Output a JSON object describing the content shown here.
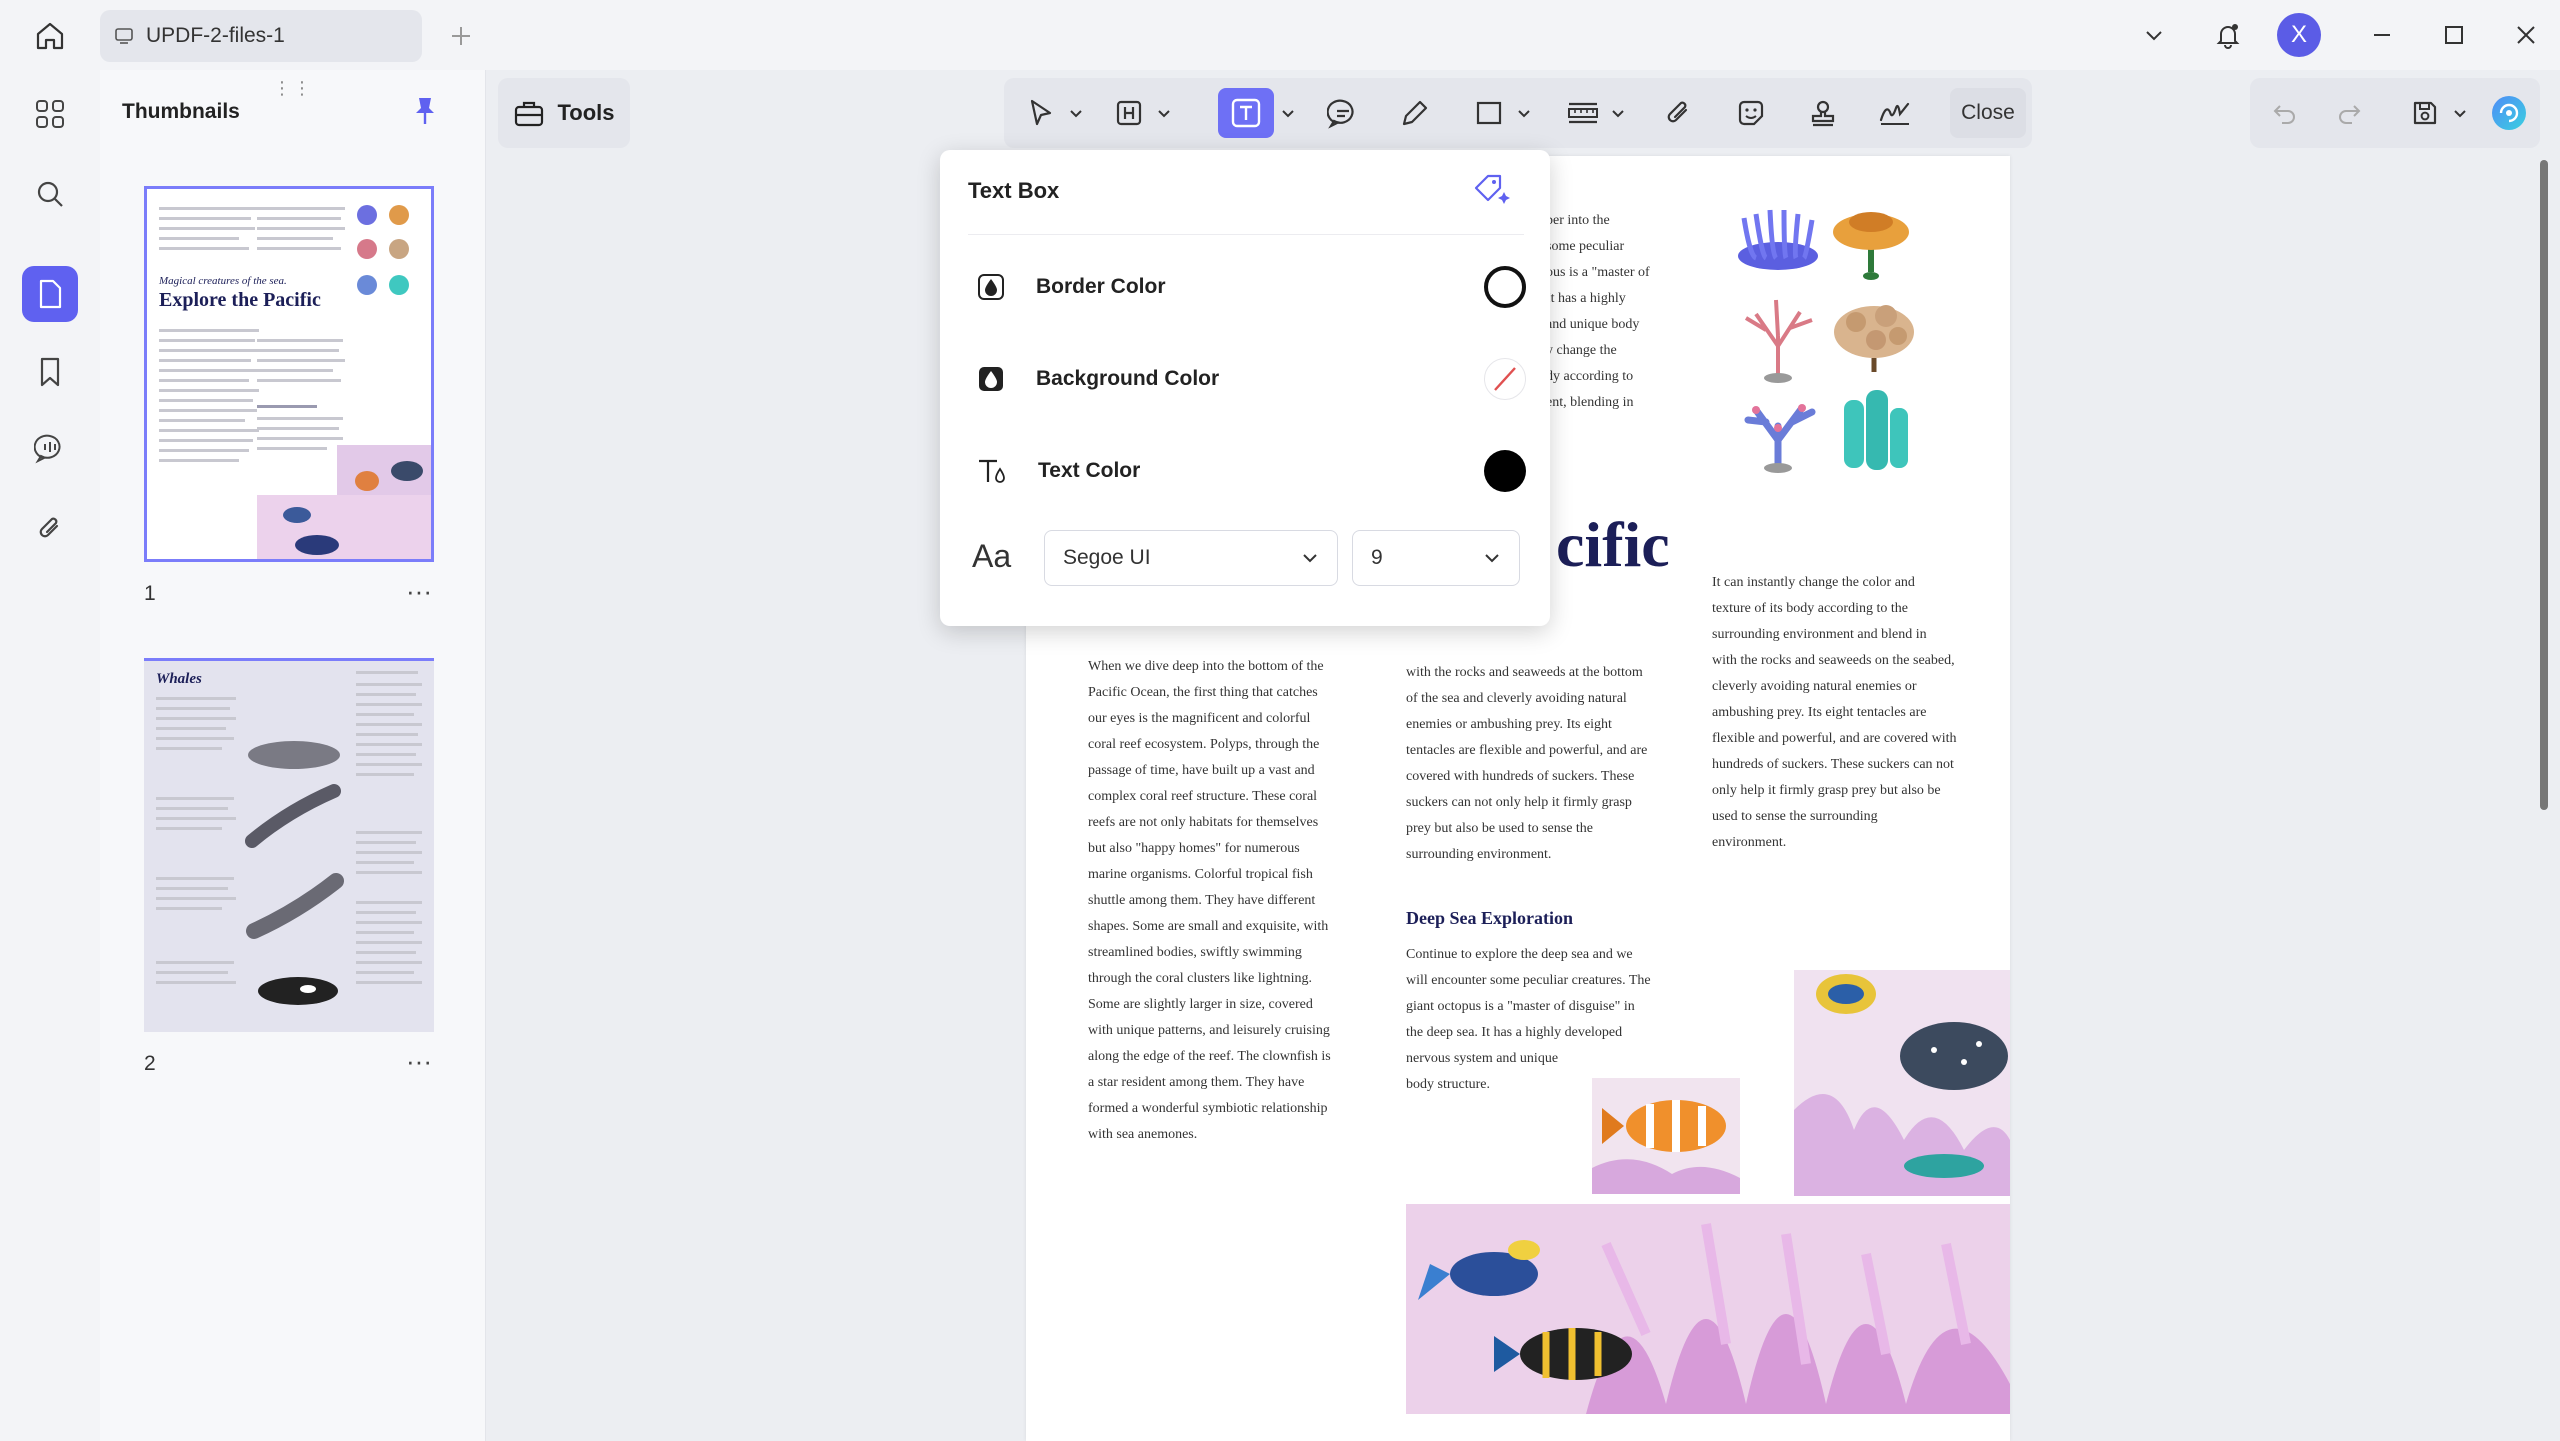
{
  "titlebar": {
    "tab_title": "UPDF-2-files-1",
    "avatar_letter": "X"
  },
  "sidebar": {
    "title": "Thumbnails",
    "pages": [
      {
        "number": "1",
        "more": "···"
      },
      {
        "number": "2",
        "more": "···"
      }
    ]
  },
  "toolbar": {
    "tools_label": "Tools",
    "close_label": "Close"
  },
  "popup": {
    "title": "Text Box",
    "border_color_label": "Border Color",
    "background_color_label": "Background Color",
    "text_color_label": "Text Color",
    "font_icon_text": "Aa",
    "font_value": "Segoe UI",
    "size_value": "9",
    "border_color": "#111111",
    "text_color": "#000000"
  },
  "page": {
    "title_fragment": "cific",
    "top_text": [
      "per into the",
      "some peculiar",
      "ous is a \"master of",
      "It has a highly",
      "and unique body",
      "y change the",
      "dy according to",
      "ent, blending in"
    ],
    "col1": [
      "When we dive deep into the bottom of the",
      "Pacific Ocean, the first thing that catches",
      "our eyes is the magnificent and colorful",
      "coral reef ecosystem. Polyps, through the",
      "passage of time, have built up a vast and",
      "complex coral reef structure. These coral",
      "reefs are not only habitats for themselves",
      "but also \"happy homes\" for numerous",
      "marine organisms. Colorful tropical fish",
      "shuttle among them. They have different",
      "shapes. Some are small and exquisite, with",
      "streamlined bodies, swiftly swimming",
      "through the coral clusters like lightning.",
      "Some are slightly larger in size, covered",
      "with unique patterns, and leisurely cruising",
      "along the edge of the reef. The clownfish is",
      "a star resident among them. They have",
      "formed a wonderful symbiotic relationship",
      "with sea anemones."
    ],
    "col2": [
      "with the rocks and seaweeds at the bottom",
      "of the sea and cleverly avoiding natural",
      "enemies or ambushing prey. Its eight",
      "tentacles are flexible and powerful, and are",
      "covered with hundreds of suckers. These",
      "suckers can not only help it firmly grasp",
      "prey but also be used to sense the",
      "surrounding environment."
    ],
    "col3": [
      "It can instantly change the color and",
      "texture of its body according to the",
      "surrounding environment and blend in",
      "with the rocks and seaweeds on the seabed,",
      "cleverly avoiding natural enemies or",
      "ambushing prey. Its eight tentacles are",
      "flexible and powerful, and are covered with",
      "hundreds of suckers. These suckers can not",
      "only help it firmly grasp prey but also be",
      "used to sense the surrounding",
      "environment."
    ],
    "section_heading": "Deep Sea Exploration",
    "section_text": [
      "Continue to explore the deep sea and we",
      "will encounter some peculiar creatures. The",
      "giant octopus is a \"master of disguise\" in",
      "the deep sea. It has a highly developed",
      "nervous system and unique",
      "body structure."
    ]
  },
  "thumb1": {
    "subtitle": "Magical creatures of the sea.",
    "title": "Explore the Pacific"
  },
  "thumb2": {
    "title": "Whales"
  },
  "colors": {
    "accent": "#5f61f0",
    "heading": "#1c1f58"
  }
}
